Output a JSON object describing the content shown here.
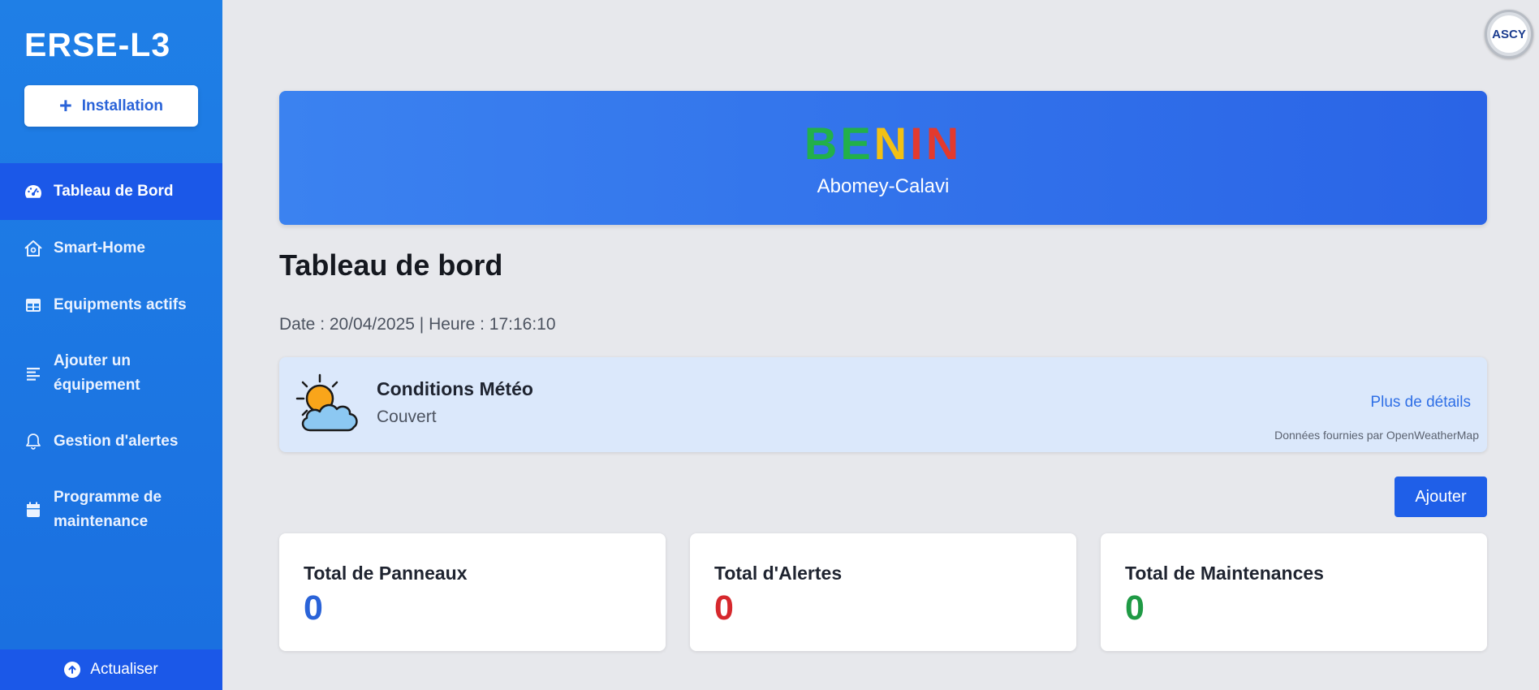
{
  "sidebar": {
    "brand": "ERSE-L3",
    "install_label": "Installation",
    "items": [
      {
        "label": "Tableau de Bord",
        "icon": "gauge-icon",
        "active": true
      },
      {
        "label": "Smart-Home",
        "icon": "house-icon"
      },
      {
        "label": "Equipments actifs",
        "icon": "table-icon"
      },
      {
        "label": "Ajouter un équipement",
        "icon": "list-icon"
      },
      {
        "label": "Gestion d'alertes",
        "icon": "bell-icon"
      },
      {
        "label": "Programme de maintenance",
        "icon": "calendar-icon"
      }
    ],
    "refresh_label": "Actualiser"
  },
  "avatar": {
    "text": "ASCY"
  },
  "hero": {
    "country_letters": [
      {
        "char": "B",
        "color": "#22b04a"
      },
      {
        "char": "E",
        "color": "#22b04a"
      },
      {
        "char": "N",
        "color": "#f2c014"
      },
      {
        "char": "I",
        "color": "#e33a2e"
      },
      {
        "char": "N",
        "color": "#e33a2e"
      }
    ],
    "city": "Abomey-Calavi"
  },
  "page": {
    "title": "Tableau de bord",
    "datetime": "Date : 20/04/2025 | Heure : 17:16:10"
  },
  "weather": {
    "icon": "partly-cloudy-icon",
    "title": "Conditions Météo",
    "description": "Couvert",
    "details_link": "Plus de détails",
    "source": "Données fournies par OpenWeatherMap"
  },
  "actions": {
    "add_label": "Ajouter"
  },
  "stats": [
    {
      "title": "Total de Panneaux",
      "value": "0",
      "color": "#2a63d8"
    },
    {
      "title": "Total d'Alertes",
      "value": "0",
      "color": "#d6282d"
    },
    {
      "title": "Total de Maintenances",
      "value": "0",
      "color": "#1f9a45"
    }
  ]
}
